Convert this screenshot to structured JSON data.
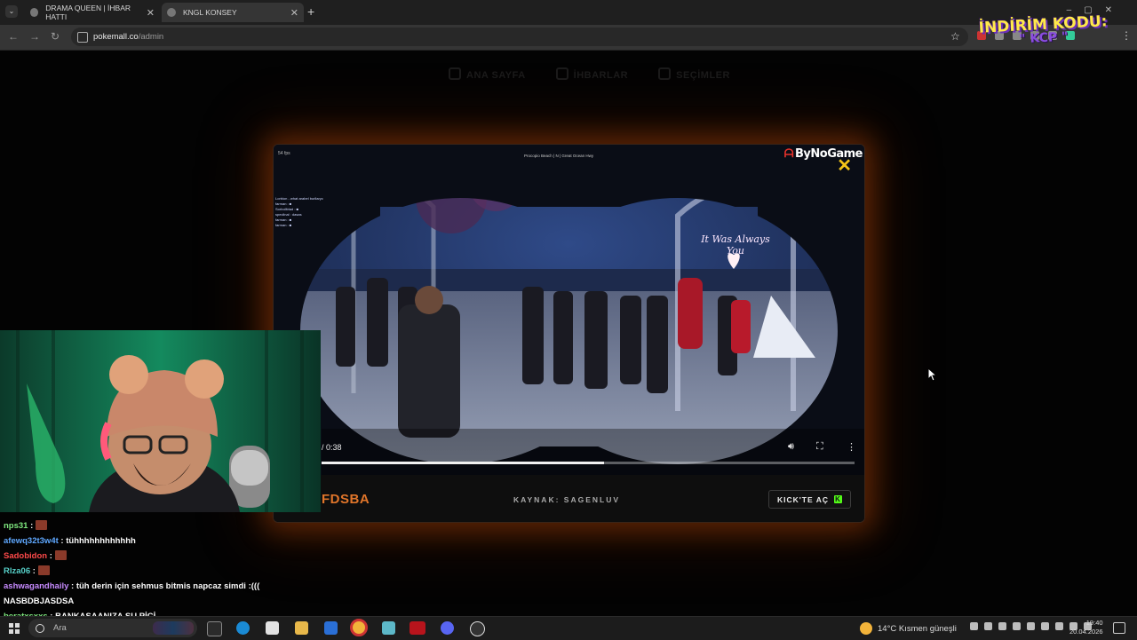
{
  "browser": {
    "tabs": [
      {
        "label": "DRAMA QUEEN | İHBAR HATTI",
        "active": false
      },
      {
        "label": "KNGL KONSEY",
        "active": true
      }
    ],
    "url_host": "pokemall.co",
    "url_path": "/admin"
  },
  "overlay": {
    "discount_title": "İNDİRİM KODU:",
    "discount_code": "\" KCP \""
  },
  "site_nav": [
    {
      "label": "ANA SAYFA",
      "icon": "home-icon"
    },
    {
      "label": "İHBARLAR",
      "icon": "report-icon"
    },
    {
      "label": "SEÇİMLER",
      "icon": "vote-icon"
    }
  ],
  "modal": {
    "watermark": "ByNoGame",
    "video_time": "/ 0:38",
    "progress_fraction": 0.53,
    "hud": {
      "fps": "54 fps",
      "location": "Procopio Beach  |  N  |  Great Ocean Hwy",
      "chat_lines": [
        "Lorbion - what arabel burllaryc",
        "farman : ■",
        "Sorbolltriad : ■",
        "speclinal : dasas",
        "farman : ■",
        "farman : ■"
      ]
    },
    "neon_sign": [
      "It Was Always",
      "You"
    ],
    "footer_title": "FDSBA",
    "footer_source": "KAYNAK: SAGENLUV",
    "kick_button": "KICK'TE AÇ",
    "kick_glyph": "K"
  },
  "chat": [
    {
      "user": "nps31",
      "color": "#7fe87f",
      "text": "",
      "emote": true
    },
    {
      "user": "afewq32t3w4t",
      "color": "#5fa8ff",
      "text": "tühhhhhhhhhhhh",
      "emote": false
    },
    {
      "user": "Sadobidon",
      "color": "#ff4a4a",
      "text": "",
      "emote": true
    },
    {
      "user": "Rlza06",
      "color": "#57d1c9",
      "text": "",
      "emote": true
    },
    {
      "user": "ashwagandhaily",
      "color": "#c78bff",
      "text": "tüh derin için sehmus bitmis napcaz simdi :((( NASBDBJASDSA",
      "emote": false
    },
    {
      "user": "beratxsxxs",
      "color": "#7fe87f",
      "text": "BANKASAANIZA SU PİÇİ",
      "emote": false
    }
  ],
  "taskbar": {
    "search_placeholder": "Ara",
    "weather": "14°C  Kısmen güneşli",
    "time": "19:40",
    "date": "20.04.2026"
  },
  "colors": {
    "accent_orange": "#e0752a",
    "kick_green": "#53fc18",
    "close_yellow": "#f5c518"
  }
}
